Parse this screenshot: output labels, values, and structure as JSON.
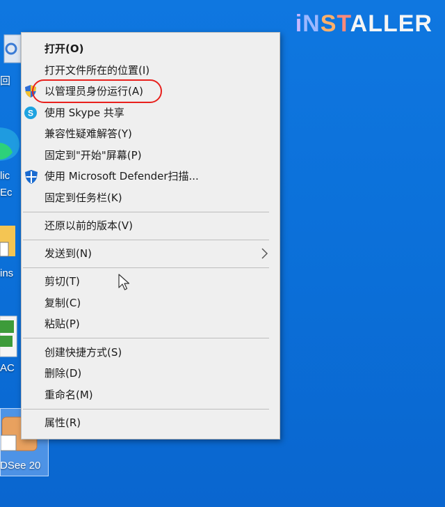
{
  "logo": {
    "parts": [
      "i",
      "N",
      "S",
      "T",
      "A",
      "LLER"
    ],
    "full": "iNSTALLER"
  },
  "desktop": {
    "labels": [
      "回",
      "lic",
      "Ec",
      "ins",
      "AC",
      "DSee 20"
    ]
  },
  "menu": {
    "items": [
      {
        "label": "打开(O)",
        "bold": true,
        "icon": ""
      },
      {
        "label": "打开文件所在的位置(I)",
        "icon": ""
      },
      {
        "label": "以管理员身份运行(A)",
        "icon": "uac-shield-icon"
      },
      {
        "label": "使用 Skype 共享",
        "icon": "skype-icon"
      },
      {
        "label": "兼容性疑难解答(Y)",
        "icon": ""
      },
      {
        "label": "固定到\"开始\"屏幕(P)",
        "icon": ""
      },
      {
        "label": "使用 Microsoft Defender扫描...",
        "icon": "defender-shield-icon"
      },
      {
        "label": "固定到任务栏(K)",
        "icon": ""
      },
      {
        "label": "还原以前的版本(V)",
        "icon": ""
      },
      {
        "label": "发送到(N)",
        "icon": "",
        "submenu": true
      },
      {
        "label": "剪切(T)",
        "icon": ""
      },
      {
        "label": "复制(C)",
        "icon": ""
      },
      {
        "label": "粘贴(P)",
        "icon": ""
      },
      {
        "label": "创建快捷方式(S)",
        "icon": ""
      },
      {
        "label": "删除(D)",
        "icon": ""
      },
      {
        "label": "重命名(M)",
        "icon": ""
      },
      {
        "label": "属性(R)",
        "icon": ""
      }
    ]
  },
  "colors": {
    "highlight_ring": "#e8201c",
    "menu_bg": "#efefef",
    "desktop_bg": "#0b6fd8"
  }
}
